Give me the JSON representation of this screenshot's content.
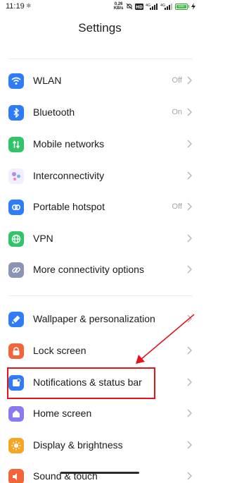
{
  "status": {
    "time": "11:19",
    "net_speed_value": "0.26",
    "net_speed_unit": "KB/s",
    "battery": "100"
  },
  "header": {
    "title": "Settings"
  },
  "group1": [
    {
      "label": "WLAN",
      "value": "Off",
      "icon": "wifi-icon",
      "color": "#2f7cf6"
    },
    {
      "label": "Bluetooth",
      "value": "On",
      "icon": "bluetooth-icon",
      "color": "#2f7cf6"
    },
    {
      "label": "Mobile networks",
      "value": "",
      "icon": "mobile-data-icon",
      "color": "#33c46a"
    },
    {
      "label": "Interconnectivity",
      "value": "",
      "icon": "interconnectivity-icon",
      "color": "#a98ef2"
    },
    {
      "label": "Portable hotspot",
      "value": "Off",
      "icon": "hotspot-icon",
      "color": "#2f7cf6"
    },
    {
      "label": "VPN",
      "value": "",
      "icon": "vpn-globe-icon",
      "color": "#33c46a"
    },
    {
      "label": "More connectivity options",
      "value": "",
      "icon": "link-icon",
      "color": "#8c94b5"
    }
  ],
  "group2": [
    {
      "label": "Wallpaper & personalization",
      "value": "",
      "icon": "brush-icon",
      "color": "#2f7cf6"
    },
    {
      "label": "Lock screen",
      "value": "",
      "icon": "lock-icon",
      "color": "#f2643a"
    },
    {
      "label": "Notifications & status bar",
      "value": "",
      "icon": "notification-icon",
      "color": "#2f7cf6"
    },
    {
      "label": "Home screen",
      "value": "",
      "icon": "home-icon",
      "color": "#8a7af0"
    },
    {
      "label": "Display & brightness",
      "value": "",
      "icon": "sun-icon",
      "color": "#f5a623"
    },
    {
      "label": "Sound & touch",
      "value": "",
      "icon": "sound-icon",
      "color": "#f2643a"
    }
  ],
  "annotation": {
    "color": "#e0161c"
  }
}
